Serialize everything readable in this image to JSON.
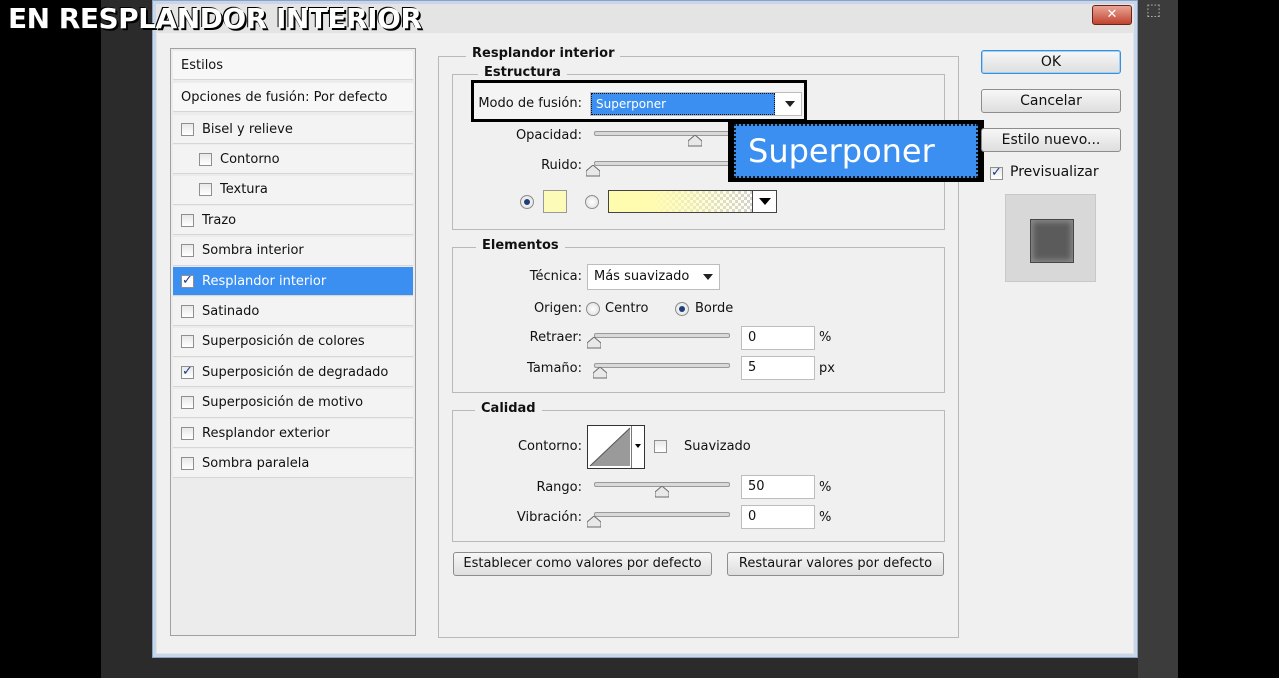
{
  "overlay_title": "EN RESPLANDOR INTERIOR",
  "window": {
    "close_label": "✕"
  },
  "styles_panel": {
    "header": "Estilos",
    "blend_options": "Opciones de fusión: Por defecto",
    "items": [
      {
        "label": "Bisel y relieve",
        "checked": false,
        "indent": false
      },
      {
        "label": "Contorno",
        "checked": false,
        "indent": true
      },
      {
        "label": "Textura",
        "checked": false,
        "indent": true
      },
      {
        "label": "Trazo",
        "checked": false,
        "indent": false
      },
      {
        "label": "Sombra interior",
        "checked": false,
        "indent": false
      },
      {
        "label": "Resplandor interior",
        "checked": true,
        "indent": false,
        "selected": true
      },
      {
        "label": "Satinado",
        "checked": false,
        "indent": false
      },
      {
        "label": "Superposición de colores",
        "checked": false,
        "indent": false
      },
      {
        "label": "Superposición de degradado",
        "checked": true,
        "indent": false
      },
      {
        "label": "Superposición de motivo",
        "checked": false,
        "indent": false
      },
      {
        "label": "Resplandor exterior",
        "checked": false,
        "indent": false
      },
      {
        "label": "Sombra paralela",
        "checked": false,
        "indent": false
      }
    ]
  },
  "main": {
    "section_title": "Resplandor interior",
    "structure": {
      "title": "Estructura",
      "blend_mode_label": "Modo de fusión:",
      "blend_mode_value": "Superponer",
      "opacity_label": "Opacidad:",
      "noise_label": "Ruido:",
      "swatch_color": "#fdfbb8",
      "gradient_color": "#fffcb0"
    },
    "elements": {
      "title": "Elementos",
      "technique_label": "Técnica:",
      "technique_value": "Más suavizado",
      "origin_label": "Origen:",
      "origin_center": "Centro",
      "origin_edge": "Borde",
      "choke_label": "Retraer:",
      "choke_value": "0",
      "choke_unit": "%",
      "choke_level": 0,
      "size_label": "Tamaño:",
      "size_value": "5",
      "size_unit": "px"
    },
    "quality": {
      "title": "Calidad",
      "contour_label": "Contorno:",
      "antialias_label": "Suavizado",
      "range_label": "Rango:",
      "range_value": "50",
      "range_unit": "%",
      "range_level": 50,
      "jitter_label": "Vibración:",
      "jitter_value": "0",
      "jitter_unit": "%",
      "jitter_level": 0
    },
    "make_default": "Establecer como valores por defecto",
    "reset_default": "Restaurar valores por defecto"
  },
  "zoom_callout": {
    "text": "Superponer"
  },
  "actions": {
    "ok": "OK",
    "cancel": "Cancelar",
    "new_style": "Estilo nuevo...",
    "preview_label": "Previsualizar",
    "preview_checked": true
  }
}
